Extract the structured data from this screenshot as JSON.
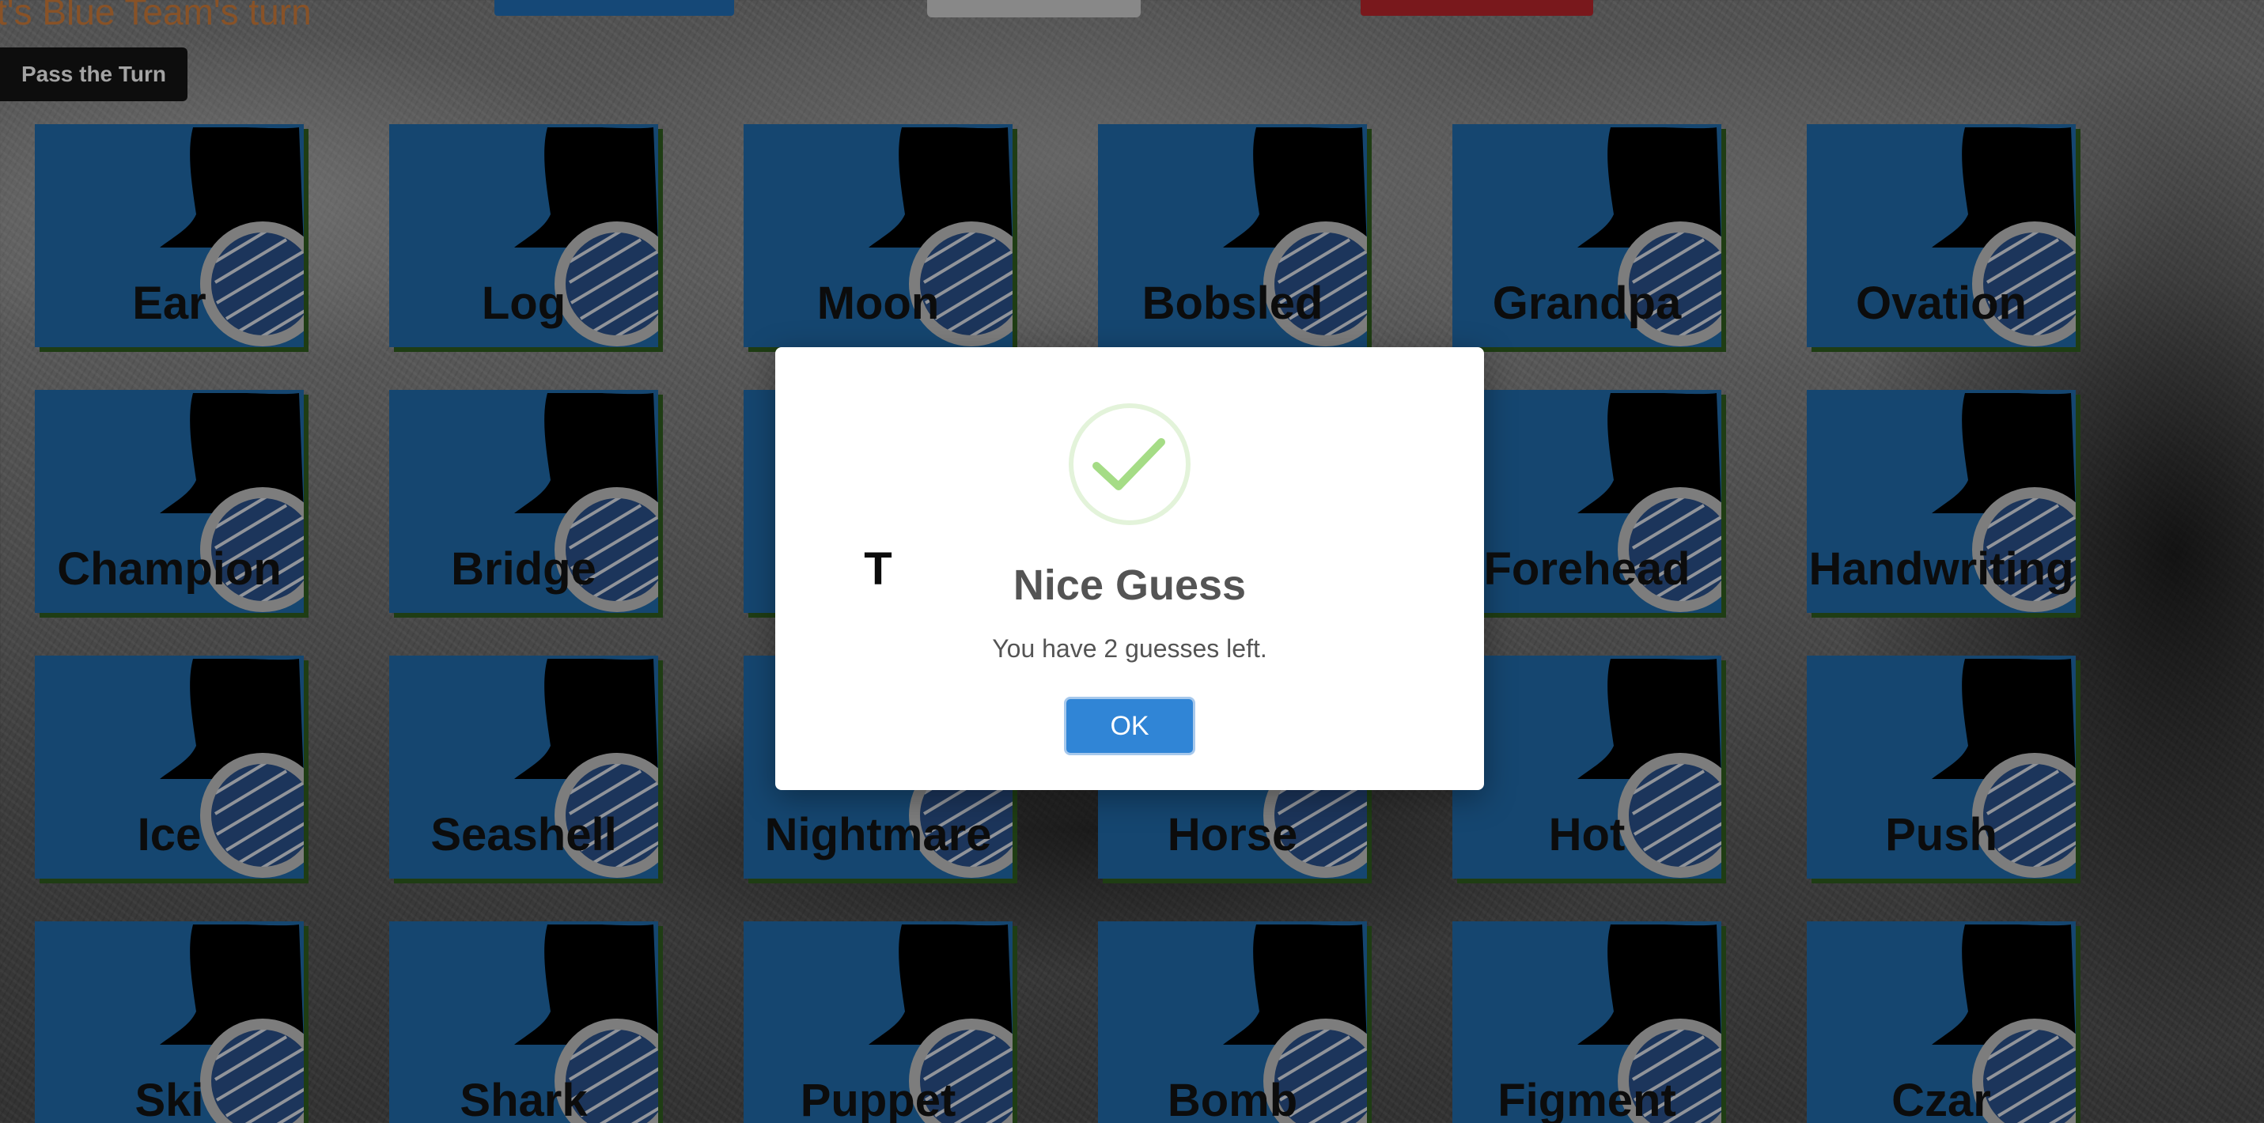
{
  "header": {
    "turn_text": "t's Blue Team's turn",
    "pass_button_label": "Pass the Turn",
    "indicators": [
      {
        "team": "blue",
        "color": "#1f6bb0"
      },
      {
        "team": "neutral",
        "color": "#c9c9c9"
      },
      {
        "team": "red",
        "color": "#b3242a"
      }
    ]
  },
  "board": {
    "card_color": "#1f67a6",
    "cards": [
      {
        "word": "Ear"
      },
      {
        "word": "Log"
      },
      {
        "word": "Moon"
      },
      {
        "word": "Bobsled"
      },
      {
        "word": "Grandpa"
      },
      {
        "word": "Ovation"
      },
      {
        "word": "Champion"
      },
      {
        "word": "Bridge"
      },
      {
        "word": "T"
      },
      {
        "word": ""
      },
      {
        "word": "Forehead"
      },
      {
        "word": "Handwriting"
      },
      {
        "word": "Ice"
      },
      {
        "word": "Seashell"
      },
      {
        "word": "Nightmare"
      },
      {
        "word": "Horse"
      },
      {
        "word": "Hot"
      },
      {
        "word": "Push"
      },
      {
        "word": "Ski"
      },
      {
        "word": "Shark"
      },
      {
        "word": "Puppet"
      },
      {
        "word": "Bomb"
      },
      {
        "word": "Figment"
      },
      {
        "word": "Czar"
      }
    ]
  },
  "dialog": {
    "icon": "success-check-icon",
    "title": "Nice Guess",
    "message": "You have 2 guesses left.",
    "ok_label": "OK",
    "button_color": "#3085d6"
  }
}
